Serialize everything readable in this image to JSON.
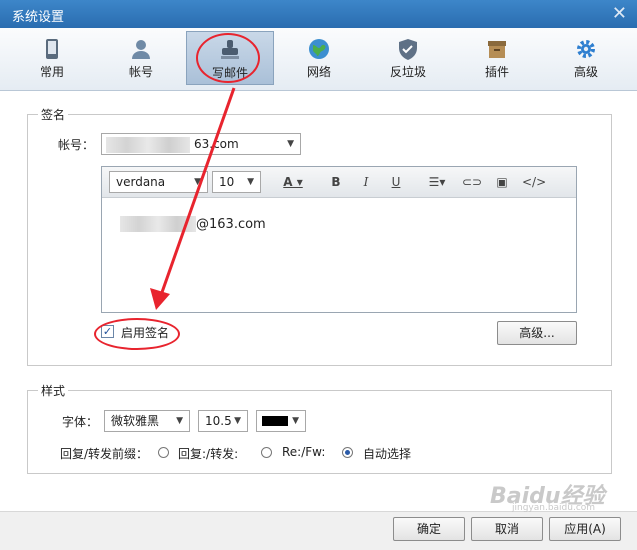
{
  "window": {
    "title": "系统设置"
  },
  "tabs": [
    {
      "label": "常用",
      "icon": "phone-icon"
    },
    {
      "label": "帐号",
      "icon": "user-icon"
    },
    {
      "label": "写邮件",
      "icon": "stamp-icon"
    },
    {
      "label": "网络",
      "icon": "globe-icon"
    },
    {
      "label": "反垃圾",
      "icon": "shield-icon"
    },
    {
      "label": "插件",
      "icon": "box-icon"
    },
    {
      "label": "高级",
      "icon": "gear-icon"
    }
  ],
  "signature": {
    "group_title": "签名",
    "account_label": "帐号：",
    "account_value_suffix": "63.com",
    "font": "verdana",
    "size": "10",
    "body_suffix": "@163.com",
    "enable_label": "启用签名",
    "enabled": true,
    "advanced_button": "高级..."
  },
  "style": {
    "group_title": "样式",
    "font_label": "字体：",
    "font_value": "微软雅黑",
    "size_value": "10.5",
    "color_value": "#000000",
    "prefix_label": "回复/转发前缀：",
    "options": [
      "回复:/转发:",
      "Re:/Fw:",
      "自动选择"
    ],
    "selected_index": 2
  },
  "footer": {
    "ok": "确定",
    "cancel": "取消",
    "apply": "应用(A)"
  },
  "watermark": {
    "text": "Baidu经验",
    "sub": "jingyan.baidu.com"
  },
  "colors": {
    "highlight": "#e8242e",
    "titlebar": "#2a6db0"
  }
}
